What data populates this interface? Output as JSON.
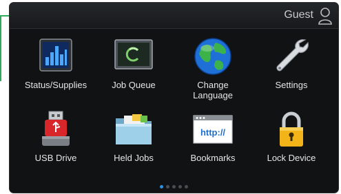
{
  "header": {
    "user_label": "Guest",
    "user_icon": "person-outline-icon"
  },
  "tiles": [
    {
      "label": "Status/Supplies",
      "icon": "bar-chart-icon"
    },
    {
      "label": "Job Queue",
      "icon": "monitor-spinner-icon"
    },
    {
      "label": "Change\nLanguage",
      "icon": "globe-icon"
    },
    {
      "label": "Settings",
      "icon": "wrench-icon"
    },
    {
      "label": "USB Drive",
      "icon": "usb-drive-icon"
    },
    {
      "label": "Held Jobs",
      "icon": "folder-icon"
    },
    {
      "label": "Bookmarks",
      "icon": "http-window-icon",
      "icon_text": "http://"
    },
    {
      "label": "Lock Device",
      "icon": "padlock-icon"
    }
  ],
  "pager": {
    "pages": 5,
    "active": 1
  },
  "colors": {
    "background": "#101214",
    "accent": "#2f8fe0",
    "callout": "#2eaa5a"
  }
}
